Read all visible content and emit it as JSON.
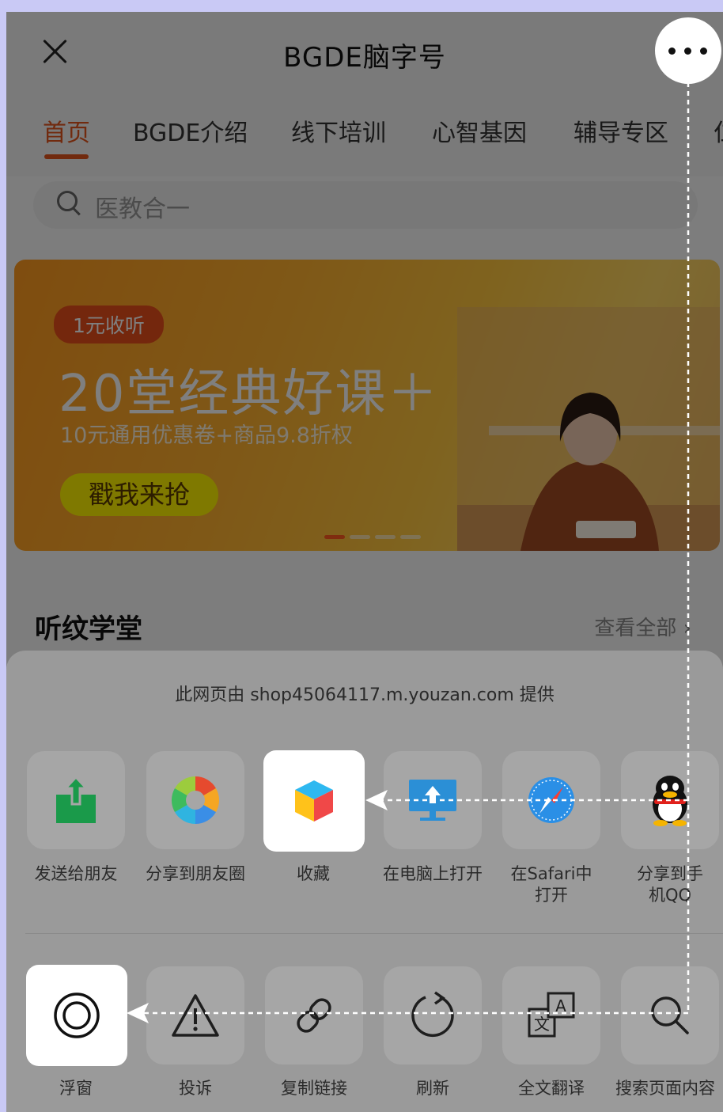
{
  "header": {
    "title": "BGDE脑字号",
    "close_icon": "close-icon",
    "more_icon": "more-dots-icon"
  },
  "tabs": [
    {
      "label": "首页",
      "active": true
    },
    {
      "label": "BGDE介绍",
      "active": false
    },
    {
      "label": "线下培训",
      "active": false
    },
    {
      "label": "心智基因",
      "active": false
    },
    {
      "label": "辅导专区",
      "active": false
    },
    {
      "label": "仁",
      "active": false
    }
  ],
  "search": {
    "placeholder": "医教合一",
    "icon": "search-icon"
  },
  "banner": {
    "badge": "1元收听",
    "title": "20堂经典好课＋",
    "subtitle": "10元通用优惠卷+商品9.8折权",
    "cta": "戳我来抢",
    "slide_count": 4,
    "active_slide": 1
  },
  "section": {
    "title": "听纹学堂",
    "more": "查看全部 ›"
  },
  "sheet": {
    "source_text": "此网页由 shop45064117.m.youzan.com 提供",
    "row1": [
      {
        "label": "发送给朋友",
        "icon": "send-to-friend-icon",
        "highlighted": false
      },
      {
        "label": "分享到朋友圈",
        "icon": "moments-icon",
        "highlighted": false
      },
      {
        "label": "收藏",
        "icon": "favorite-cube-icon",
        "highlighted": true
      },
      {
        "label": "在电脑上打开",
        "icon": "open-on-computer-icon",
        "highlighted": false
      },
      {
        "label": "在Safari中打开",
        "icon": "safari-icon",
        "highlighted": false
      },
      {
        "label": "分享到手机QQ",
        "icon": "qq-icon",
        "highlighted": false
      }
    ],
    "row2": [
      {
        "label": "浮窗",
        "icon": "floating-window-icon",
        "highlighted": true
      },
      {
        "label": "投诉",
        "icon": "warning-icon",
        "highlighted": false
      },
      {
        "label": "复制链接",
        "icon": "link-icon",
        "highlighted": false
      },
      {
        "label": "刷新",
        "icon": "refresh-icon",
        "highlighted": false
      },
      {
        "label": "全文翻译",
        "icon": "translate-icon",
        "highlighted": false
      },
      {
        "label": "搜索页面内容",
        "icon": "search-page-icon",
        "highlighted": false
      }
    ]
  },
  "colors": {
    "accent": "#e3541c",
    "banner": "#ffb02e",
    "qq_wechat_green": "#1aad19"
  }
}
